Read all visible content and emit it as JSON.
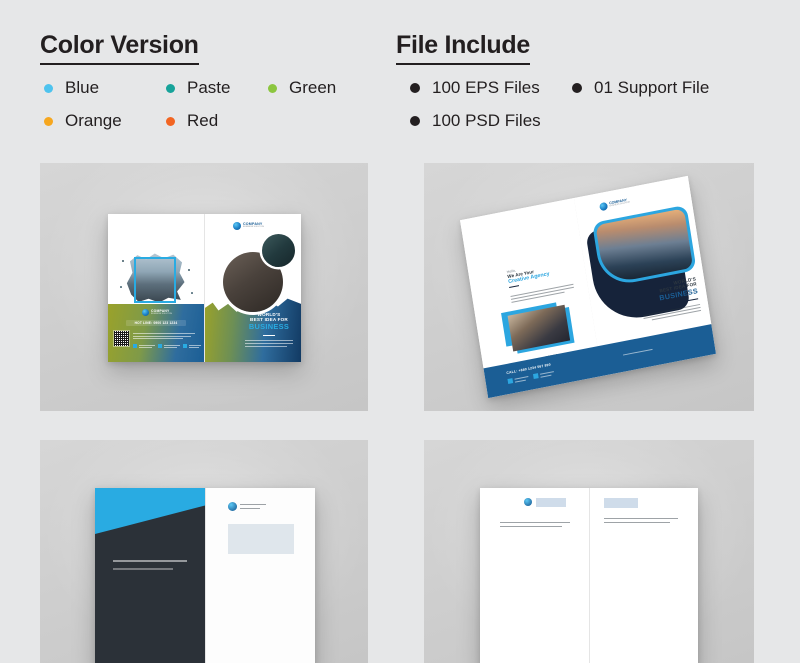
{
  "page": {
    "background_color": "#e6e7e8",
    "mockup_panel_color": "#d0d0d0"
  },
  "sections": {
    "color_version": {
      "title": "Color Version",
      "items": [
        {
          "label": "Blue",
          "color": "#4ec3ee"
        },
        {
          "label": "Paste",
          "color": "#17a39a"
        },
        {
          "label": "Green",
          "color": "#8cc63f"
        },
        {
          "label": "Orange",
          "color": "#f6a71f"
        },
        {
          "label": "Red",
          "color": "#f26522"
        }
      ]
    },
    "file_include": {
      "title": "File Include",
      "items": [
        {
          "label": "100 EPS Files",
          "color": "#231f20"
        },
        {
          "label": "01 Support File",
          "color": "#231f20"
        },
        {
          "label": "100 PSD Files",
          "color": "#231f20"
        }
      ]
    }
  },
  "mockups": [
    {
      "name": "bifold-brochure-front-back-flat",
      "row": 0,
      "column": 0,
      "brand_colors": {
        "blue": "#1a5f9e",
        "cyan": "#29abe2",
        "olive": "#9aa22a",
        "navy": "#123a63"
      },
      "content": {
        "company_name": "COMPANY",
        "company_tagline": "BUSINESS SOLUTION",
        "hotline": "HOT LINE: 0900 123 1234",
        "tagline_line1": "WORLD'S",
        "tagline_line2": "BEST IDEA FOR",
        "tagline_line3": "BUSINESS",
        "body_text": "Lorem ipsum dolor sit amet, consectetur adipiscing elit sed do eiusmod tempor incididunt ut labore et dolore magna aliqua."
      }
    },
    {
      "name": "bifold-brochure-angled-perspective",
      "row": 0,
      "column": 1,
      "brand_colors": {
        "blue": "#1b5e95",
        "cyan": "#2ca6e0",
        "navy": "#16233a"
      },
      "content": {
        "company_name": "COMPANY",
        "company_tagline": "BUSINESS SOLUTION",
        "greeting_line1": "Hello,",
        "greeting_line2": "We Are Your",
        "greeting_line3": "Creative Agency",
        "tagline_line1": "WORLD'S",
        "tagline_line2": "BEST IDEA FOR",
        "tagline_line3": "BUSINESS",
        "footer_contact": "CALL: +880 1234 567 890",
        "body_text": "Lorem ipsum dolor sit amet, consectetur adipiscing elit sed do eiusmod tempor incididunt."
      }
    },
    {
      "name": "bifold-brochure-cyan-cover-partial",
      "row": 1,
      "column": 0,
      "brand_colors": {
        "cyan": "#29abe2",
        "dark": "#2b3138"
      },
      "content": {}
    },
    {
      "name": "bifold-brochure-white-spread-partial",
      "row": 1,
      "column": 1,
      "brand_colors": {
        "blue": "#1b5e95"
      },
      "content": {}
    }
  ]
}
